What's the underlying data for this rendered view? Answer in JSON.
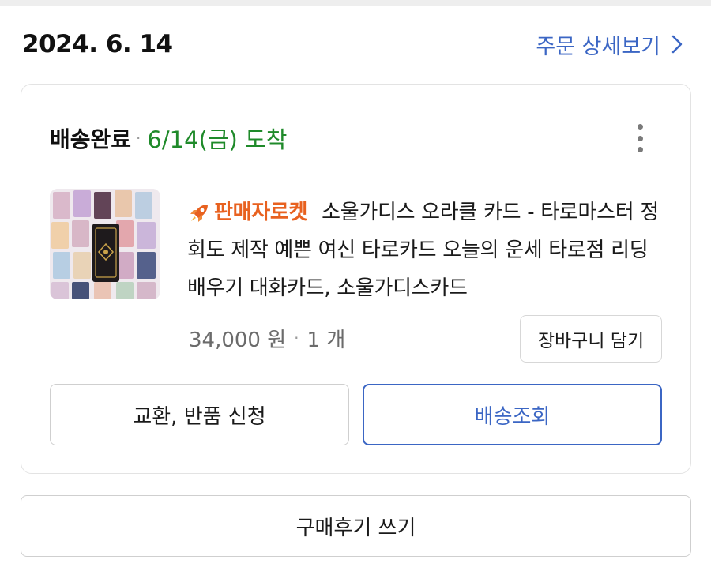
{
  "order": {
    "date": "2024. 6. 14",
    "detail_link_label": "주문 상세보기",
    "detail_link_icon": "chevron-right-icon"
  },
  "shipment": {
    "status": "배송완료",
    "separator": "·",
    "arrival": "6/14(금) 도착",
    "more_icon": "more-vertical-icon"
  },
  "product": {
    "badge_label": "판매자로켓",
    "badge_icon": "rocket-icon",
    "title": "소울가디스 오라클 카드 - 타로마스터 정회도 제작 예쁜 여신 타로카드 오늘의 운세 타로점 리딩 배우기 대화카드, 소울가디스카드",
    "price": "34,000 원",
    "separator": "·",
    "quantity": "1 개",
    "cart_button_label": "장바구니 담기"
  },
  "actions": {
    "return_label": "교환, 반품 신청",
    "tracking_label": "배송조회",
    "review_label": "구매후기 쓰기"
  },
  "colors": {
    "link_blue": "#3b66c4",
    "arrival_green": "#1f8a2a",
    "rocket_orange": "#e8611f"
  }
}
